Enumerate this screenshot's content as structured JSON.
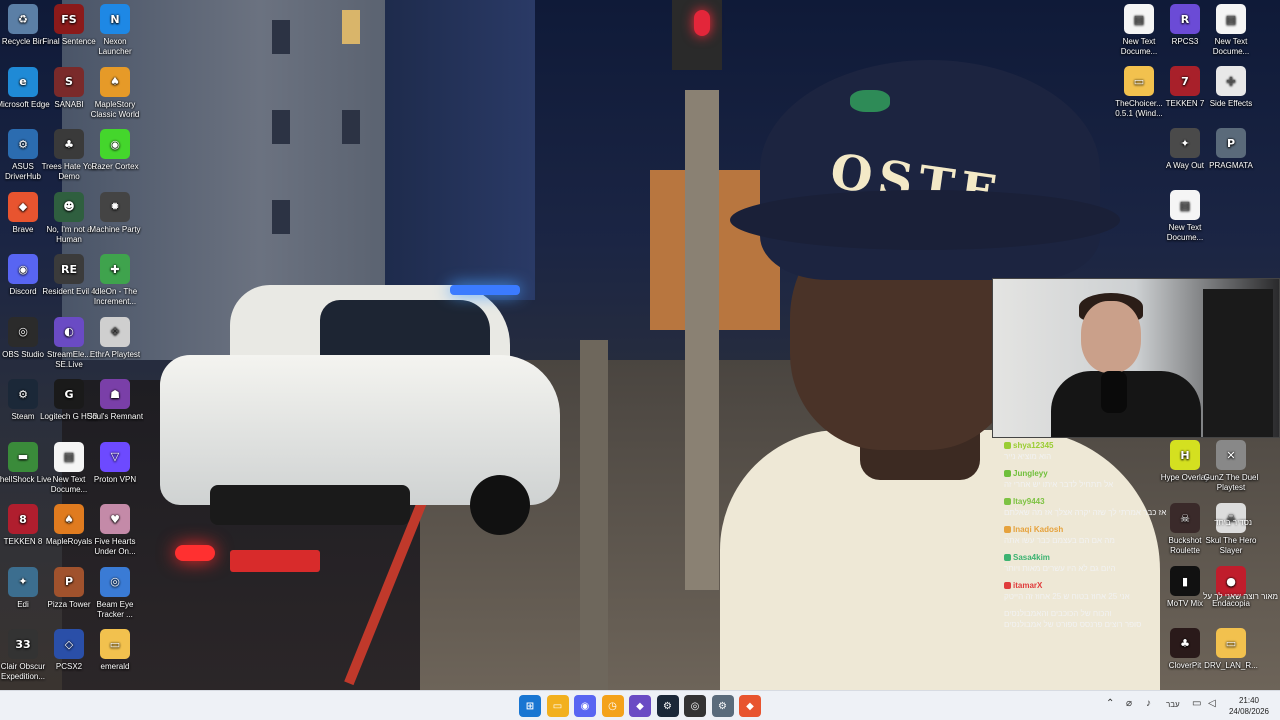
{
  "desktop_icons": [
    {
      "label": "Recycle Bin",
      "icon": "recycle-bin-icon",
      "color": "#5b7fa6",
      "glyph": "♻"
    },
    {
      "label": "Microsoft Edge",
      "icon": "edge-icon",
      "color": "#1f8ad6",
      "glyph": "e"
    },
    {
      "label": "ASUS DriverHub",
      "icon": "gear-icon",
      "color": "#2b6cb0",
      "glyph": "⚙"
    },
    {
      "label": "Brave",
      "icon": "brave-icon",
      "color": "#e8542f",
      "glyph": "◆"
    },
    {
      "label": "Discord",
      "icon": "discord-icon",
      "color": "#5865f2",
      "glyph": "◉"
    },
    {
      "label": "OBS Studio",
      "icon": "obs-icon",
      "color": "#2b2b2b",
      "glyph": "◎"
    },
    {
      "label": "Steam",
      "icon": "steam-icon",
      "color": "#1b2838",
      "glyph": "⚙"
    },
    {
      "label": "ShellShock Live",
      "icon": "tank-icon",
      "color": "#3a8b3a",
      "glyph": "▬"
    },
    {
      "label": "TEKKEN 8",
      "icon": "tekken-icon",
      "color": "#b01e2e",
      "glyph": "8"
    },
    {
      "label": "Edi",
      "icon": "edi-icon",
      "color": "#3c6e8f",
      "glyph": "✦"
    },
    {
      "label": "Clair Obscur Expedition...",
      "icon": "clair-obscur-icon",
      "color": "#333333",
      "glyph": "33"
    },
    {
      "label": "Final Sentence",
      "icon": "final-sentence-icon",
      "color": "#8b1a1a",
      "glyph": "FS"
    },
    {
      "label": "SANABI",
      "icon": "sanabi-icon",
      "color": "#7a2a2a",
      "glyph": "S"
    },
    {
      "label": "Trees Hate You Demo",
      "icon": "tree-icon",
      "color": "#3a3a3a",
      "glyph": "♣"
    },
    {
      "label": "No, I'm not a Human",
      "icon": "no-human-icon",
      "color": "#2f5f3f",
      "glyph": "☻"
    },
    {
      "label": "Resident Evil 4",
      "icon": "resident-evil-icon",
      "color": "#3b3b3b",
      "glyph": "RE"
    },
    {
      "label": "StreamEle... SE.Live",
      "icon": "streamelements-icon",
      "color": "#6a4bc4",
      "glyph": "◐"
    },
    {
      "label": "Logitech G HUB",
      "icon": "logitech-icon",
      "color": "#1a1a1a",
      "glyph": "G"
    },
    {
      "label": "New Text Docume...",
      "icon": "text-document-icon",
      "color": "#f5f5f5",
      "glyph": "▤"
    },
    {
      "label": "MapleRoyals",
      "icon": "mushroom-icon",
      "color": "#e07b1f",
      "glyph": "♠"
    },
    {
      "label": "Pizza Tower",
      "icon": "pizza-tower-icon",
      "color": "#a0522d",
      "glyph": "P"
    },
    {
      "label": "PCSX2",
      "icon": "pcsx2-icon",
      "color": "#2a4fa8",
      "glyph": "◇"
    },
    {
      "label": "Nexon Launcher",
      "icon": "nexon-icon",
      "color": "#1e88e5",
      "glyph": "N"
    },
    {
      "label": "MapleStory Classic World",
      "icon": "maplestory-icon",
      "color": "#e69a28",
      "glyph": "♠"
    },
    {
      "label": "Razer Cortex",
      "icon": "razer-icon",
      "color": "#44d62c",
      "glyph": "◉"
    },
    {
      "label": "Machine Party",
      "icon": "machine-party-icon",
      "color": "#444444",
      "glyph": "✹"
    },
    {
      "label": "IdleOn - The Increment...",
      "icon": "idleon-icon",
      "color": "#3fa34d",
      "glyph": "✚"
    },
    {
      "label": "EthrA Playtest",
      "icon": "ethra-icon",
      "color": "#cfcfcf",
      "glyph": "❖"
    },
    {
      "label": "Soul's Remnant",
      "icon": "souls-remnant-icon",
      "color": "#7a3fa8",
      "glyph": "☗"
    },
    {
      "label": "Proton VPN",
      "icon": "proton-vpn-icon",
      "color": "#6d4aff",
      "glyph": "▽"
    },
    {
      "label": "Five Hearts Under On...",
      "icon": "five-hearts-icon",
      "color": "#c48aa8",
      "glyph": "♥"
    },
    {
      "label": "Beam Eye Tracker ...",
      "icon": "eye-tracker-icon",
      "color": "#3a7bd5",
      "glyph": "◎"
    },
    {
      "label": "emerald",
      "icon": "folder-icon",
      "color": "#f2c14e",
      "glyph": "▭"
    }
  ],
  "right_icons": [
    {
      "label": "New Text Docume...",
      "icon": "text-document-icon",
      "color": "#f5f5f5",
      "glyph": "▤"
    },
    {
      "label": "RPCS3",
      "icon": "rpcs3-icon",
      "color": "#6b4bd6",
      "glyph": "R"
    },
    {
      "label": "New Text Docume...",
      "icon": "text-document-icon",
      "color": "#f5f5f5",
      "glyph": "▤"
    },
    {
      "label": "TheChoicer... 0.5.1 (Wind...",
      "icon": "folder-icon",
      "color": "#f2c14e",
      "glyph": "▭"
    },
    {
      "label": "TEKKEN 7",
      "icon": "tekken-icon",
      "color": "#a8202a",
      "glyph": "7"
    },
    {
      "label": "Side Effects",
      "icon": "side-effects-icon",
      "color": "#e8e8e8",
      "glyph": "✣"
    },
    {
      "label": "A Way Out",
      "icon": "a-way-out-icon",
      "color": "#4a4a4a",
      "glyph": "✦"
    },
    {
      "label": "PRAGMATA",
      "icon": "pragmata-icon",
      "color": "#5a6a7a",
      "glyph": "P"
    },
    {
      "label": "New Text Docume...",
      "icon": "text-document-icon",
      "color": "#f5f5f5",
      "glyph": "▤"
    },
    {
      "label": "Hype Overlay",
      "icon": "hype-overlay-icon",
      "color": "#d4e020",
      "glyph": "H"
    },
    {
      "label": "GunZ The Duel Playtest",
      "icon": "gunz-icon",
      "color": "#888888",
      "glyph": "✕"
    },
    {
      "label": "Buckshot Roulette",
      "icon": "buckshot-icon",
      "color": "#3a2a2a",
      "glyph": "☠"
    },
    {
      "label": "Skul The Hero Slayer",
      "icon": "skul-icon",
      "color": "#dddddd",
      "glyph": "☠"
    },
    {
      "label": "MoTV Mix",
      "icon": "motv-icon",
      "color": "#111111",
      "glyph": "▮"
    },
    {
      "label": "Endacopia",
      "icon": "endacopia-icon",
      "color": "#c01d2c",
      "glyph": "●"
    },
    {
      "label": "CloverPit",
      "icon": "cloverpit-icon",
      "color": "#2a1a1a",
      "glyph": "♣"
    },
    {
      "label": "DRV_LAN_R...",
      "icon": "folder-icon",
      "color": "#f2c14e",
      "glyph": "▭"
    }
  ],
  "chat": [
    {
      "user": "shya12345",
      "user_color": "#9acd32",
      "text": "הוא מוציא נייר"
    },
    {
      "user": "Jungleyy",
      "user_color": "#6fbf3a",
      "text": "אל תתחיל לדבר איתו יש אחרי זה"
    },
    {
      "user": "Itay9443",
      "user_color": "#7dc242",
      "text": "אז כבר אמרתי לך שזה יקרה אצלך אז מה שאלתם"
    },
    {
      "user": "Inaqi Kadosh",
      "user_color": "#e6a23c",
      "text": "מה אם הם בעצמם כבר עשו אתה"
    },
    {
      "user": "Sasa4kim",
      "user_color": "#3cb371",
      "text": "היום גם לא היו עשרים מאות ויותר"
    },
    {
      "user": "itamarX",
      "user_color": "#e03c3c",
      "text": "אני 25 אחוז בטוח ש 25 אחוז זה הייטק"
    }
  ],
  "overlay_text": {
    "chat_line_a": "והכוח של הכוכבים והאמבולנסים",
    "chat_line_b": "סופר רוצים פרנסס ספורט של אמבולנסים",
    "overlay_right": "מאור רוצה שאני לך על",
    "overlay_right2": "נסדיר ביחד",
    "hat_text": "OSTE"
  },
  "taskbar": {
    "apps": [
      {
        "name": "start-button",
        "icon": "windows-icon",
        "color": "#1976d2",
        "glyph": "⊞"
      },
      {
        "name": "file-explorer",
        "icon": "folder-icon",
        "color": "#f2b01e",
        "glyph": "▭"
      },
      {
        "name": "discord",
        "icon": "discord-icon",
        "color": "#5865f2",
        "glyph": "◉"
      },
      {
        "name": "timer-app",
        "icon": "clock-icon",
        "color": "#f4a21a",
        "glyph": "◷"
      },
      {
        "name": "streamelements",
        "icon": "streamelements-icon",
        "color": "#6a4bc4",
        "glyph": "◆"
      },
      {
        "name": "steam",
        "icon": "steam-icon",
        "color": "#1b2838",
        "glyph": "⚙"
      },
      {
        "name": "obs",
        "icon": "obs-icon",
        "color": "#333333",
        "glyph": "◎"
      },
      {
        "name": "settings",
        "icon": "gear-icon",
        "color": "#5a6b7b",
        "glyph": "⚙"
      },
      {
        "name": "brave",
        "icon": "brave-icon",
        "color": "#e8542f",
        "glyph": "◆"
      }
    ],
    "language": "עבר",
    "time": "21:40",
    "date": "24/08/2026"
  }
}
